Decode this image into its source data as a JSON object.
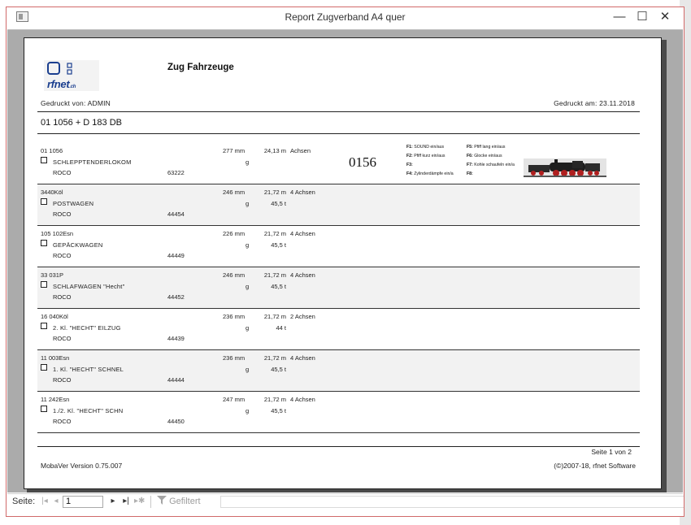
{
  "window": {
    "title": "Report Zugverband A4 quer",
    "minimize_label": "—",
    "maximize_label": "☐",
    "close_label": "✕"
  },
  "report": {
    "logo_text": "rfnet",
    "logo_suffix": ".ch",
    "title": "Zug Fahrzeuge",
    "printed_by": "Gedruckt von: ADMIN",
    "printed_at": "Gedruckt am: 23.11.2018",
    "train": "01 1056 + D 183 DB",
    "vehicles": [
      {
        "number": "01 1056",
        "type": "SCHLEPPTENDERLOKOM",
        "manufacturer": "ROCO",
        "article": "63222",
        "length": "277 mm",
        "unit_g": "g",
        "lup": "24,13 m",
        "weight": "",
        "axles": "Achsen",
        "address": "0156",
        "functions": [
          {
            "key": "F1:",
            "text": "SOUND ein/aus"
          },
          {
            "key": "F2:",
            "text": "Pfiff kurz ein/aus"
          },
          {
            "key": "F3:",
            "text": ""
          },
          {
            "key": "F4:",
            "text": "Zylinderdämpfe ein/a"
          },
          {
            "key": "F5:",
            "text": "Pfiff lang ein/aus"
          },
          {
            "key": "F6:",
            "text": "Glocke ein/aus"
          },
          {
            "key": "F7:",
            "text": "Kohle schaufeln ein/a"
          },
          {
            "key": "F8:",
            "text": ""
          }
        ]
      },
      {
        "number": "3440Köl",
        "type": "POSTWAGEN",
        "manufacturer": "ROCO",
        "article": "44454",
        "length": "246 mm",
        "unit_g": "g",
        "lup": "21,72 m",
        "weight": "45,5 t",
        "axles": "4 Achsen"
      },
      {
        "number": "105 102Esn",
        "type": "GEPÄCKWAGEN",
        "manufacturer": "ROCO",
        "article": "44449",
        "length": "226 mm",
        "unit_g": "g",
        "lup": "21,72 m",
        "weight": "45,5 t",
        "axles": "4 Achsen"
      },
      {
        "number": "33 031P",
        "type": "SCHLAFWAGEN \"Hecht\"",
        "manufacturer": "ROCO",
        "article": "44452",
        "length": "246 mm",
        "unit_g": "g",
        "lup": "21,72 m",
        "weight": "45,5 t",
        "axles": "4 Achsen"
      },
      {
        "number": "16 040Köl",
        "type": "2. Kl. \"HECHT\" EILZUG",
        "manufacturer": "ROCO",
        "article": "44439",
        "length": "236 mm",
        "unit_g": "g",
        "lup": "21,72 m",
        "weight": "44 t",
        "axles": "2 Achsen"
      },
      {
        "number": "11 003Esn",
        "type": "1. Kl. \"HECHT\" SCHNEL",
        "manufacturer": "ROCO",
        "article": "44444",
        "length": "236 mm",
        "unit_g": "g",
        "lup": "21,72 m",
        "weight": "45,5 t",
        "axles": "4 Achsen"
      },
      {
        "number": "11 242Esn",
        "type": "1./2. Kl. \"HECHT\" SCHN",
        "manufacturer": "ROCO",
        "article": "44450",
        "length": "247 mm",
        "unit_g": "g",
        "lup": "21,72 m",
        "weight": "45,5 t",
        "axles": "4 Achsen"
      }
    ],
    "page_info": "Seite 1 von 2",
    "version": "MobaVer Version 0.75.007",
    "copyright": "(©)2007-18, rfnet Software"
  },
  "navbar": {
    "label": "Seite:",
    "page_value": "1",
    "filter_label": "Gefiltert"
  }
}
